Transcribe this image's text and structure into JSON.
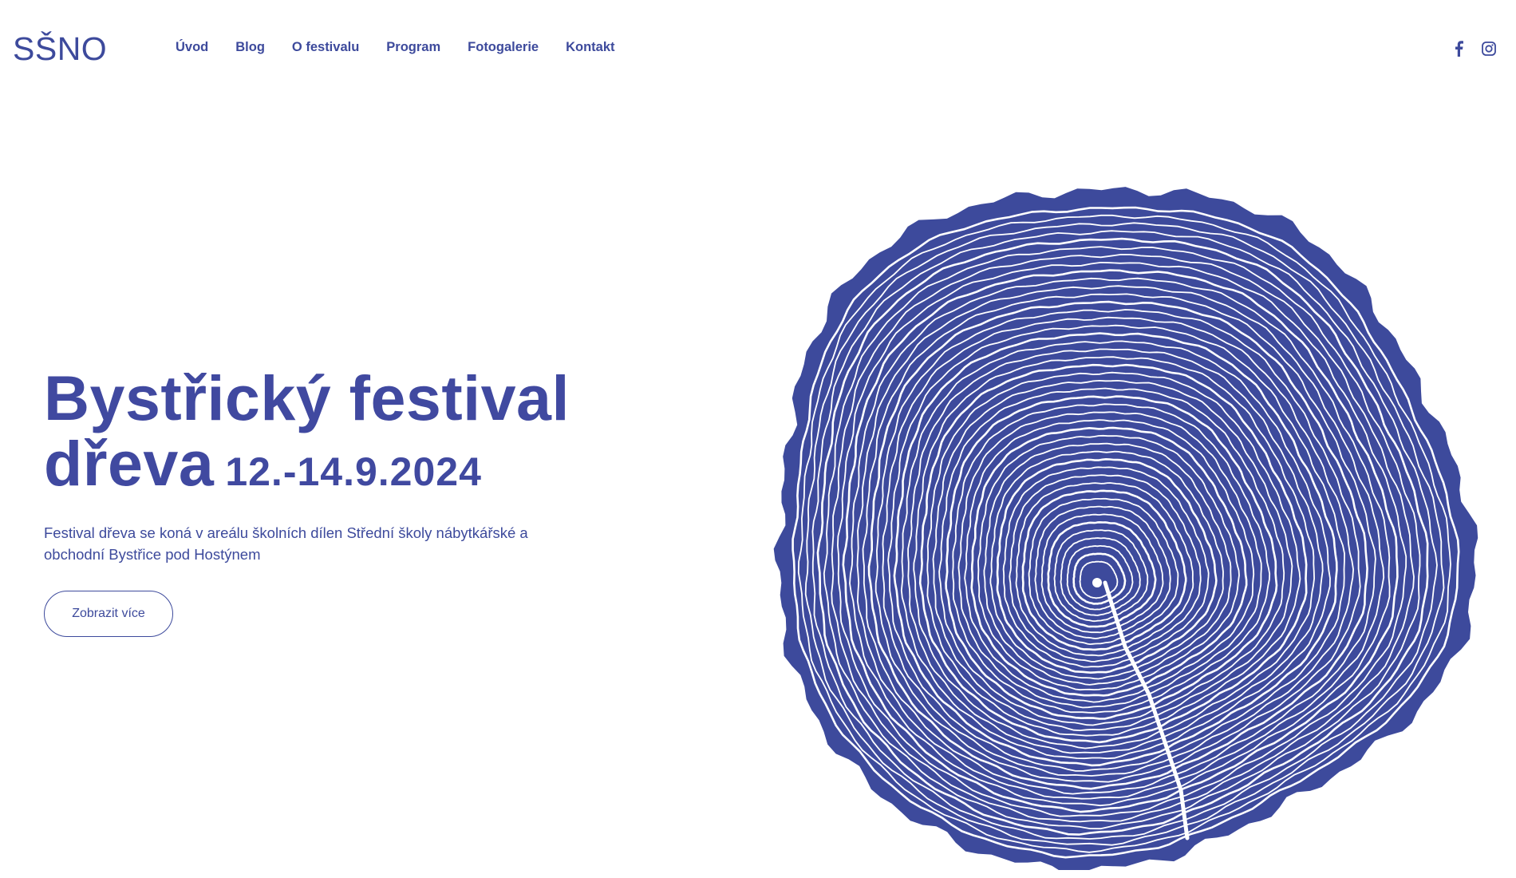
{
  "header": {
    "logo": "SŠNO",
    "nav": [
      {
        "label": "Úvod"
      },
      {
        "label": "Blog"
      },
      {
        "label": "O festivalu"
      },
      {
        "label": "Program"
      },
      {
        "label": "Fotogalerie"
      },
      {
        "label": "Kontakt"
      }
    ],
    "social": [
      "facebook-icon",
      "instagram-icon"
    ]
  },
  "hero": {
    "title_line1": "Bystřický festival",
    "title_line2": "dřeva",
    "date": "12.-14.9.2024",
    "description": "Festival dřeva se koná v areálu školních dílen Střední školy nábytkářské a obchodní Bystřice pod Hostýnem",
    "cta_label": "Zobrazit více"
  },
  "colors": {
    "brand": "#3d4a9c",
    "background": "#ffffff"
  },
  "illustration": "tree-rings-icon"
}
